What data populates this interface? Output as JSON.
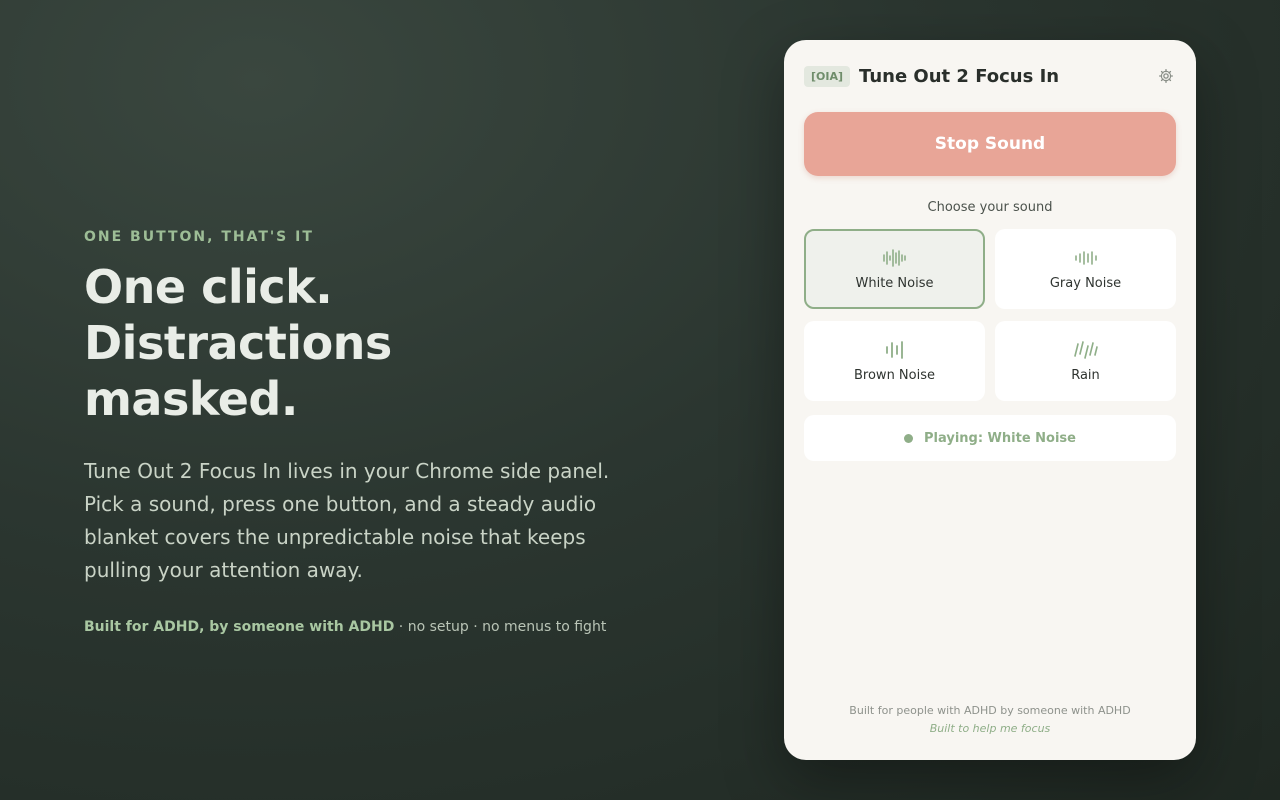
{
  "hero": {
    "eyebrow": "ONE BUTTON, THAT'S IT",
    "headline_line1": "One click. Distractions",
    "headline_line2": "masked.",
    "lede": "Tune Out 2 Focus In lives in your Chrome side panel. Pick a sound, press one button, and a steady audio blanket covers the unpredictable noise that keeps pulling your attention away.",
    "tagline_strong": "Built for ADHD, by someone with ADHD",
    "tagline_rest": " · no setup · no menus to fight"
  },
  "panel": {
    "badge": "[OIA]",
    "title": "Tune Out 2 Focus In",
    "settings_icon": "gear-icon",
    "stop_button": "Stop Sound",
    "choose_label": "Choose your sound",
    "sounds": [
      {
        "label": "White Noise",
        "icon": "waveform-dense-icon",
        "selected": true
      },
      {
        "label": "Gray Noise",
        "icon": "waveform-medium-icon",
        "selected": false
      },
      {
        "label": "Brown Noise",
        "icon": "waveform-sparse-icon",
        "selected": false
      },
      {
        "label": "Rain",
        "icon": "rain-icon",
        "selected": false
      }
    ],
    "status": "Playing: White Noise",
    "footer_line1": "Built for people with ADHD by someone with ADHD",
    "footer_line2": "Built to help me focus"
  },
  "colors": {
    "accent_green": "#8fae88",
    "stop_button": "#e8a597",
    "panel_bg": "#f8f6f2",
    "page_bg": "#2b3630"
  }
}
